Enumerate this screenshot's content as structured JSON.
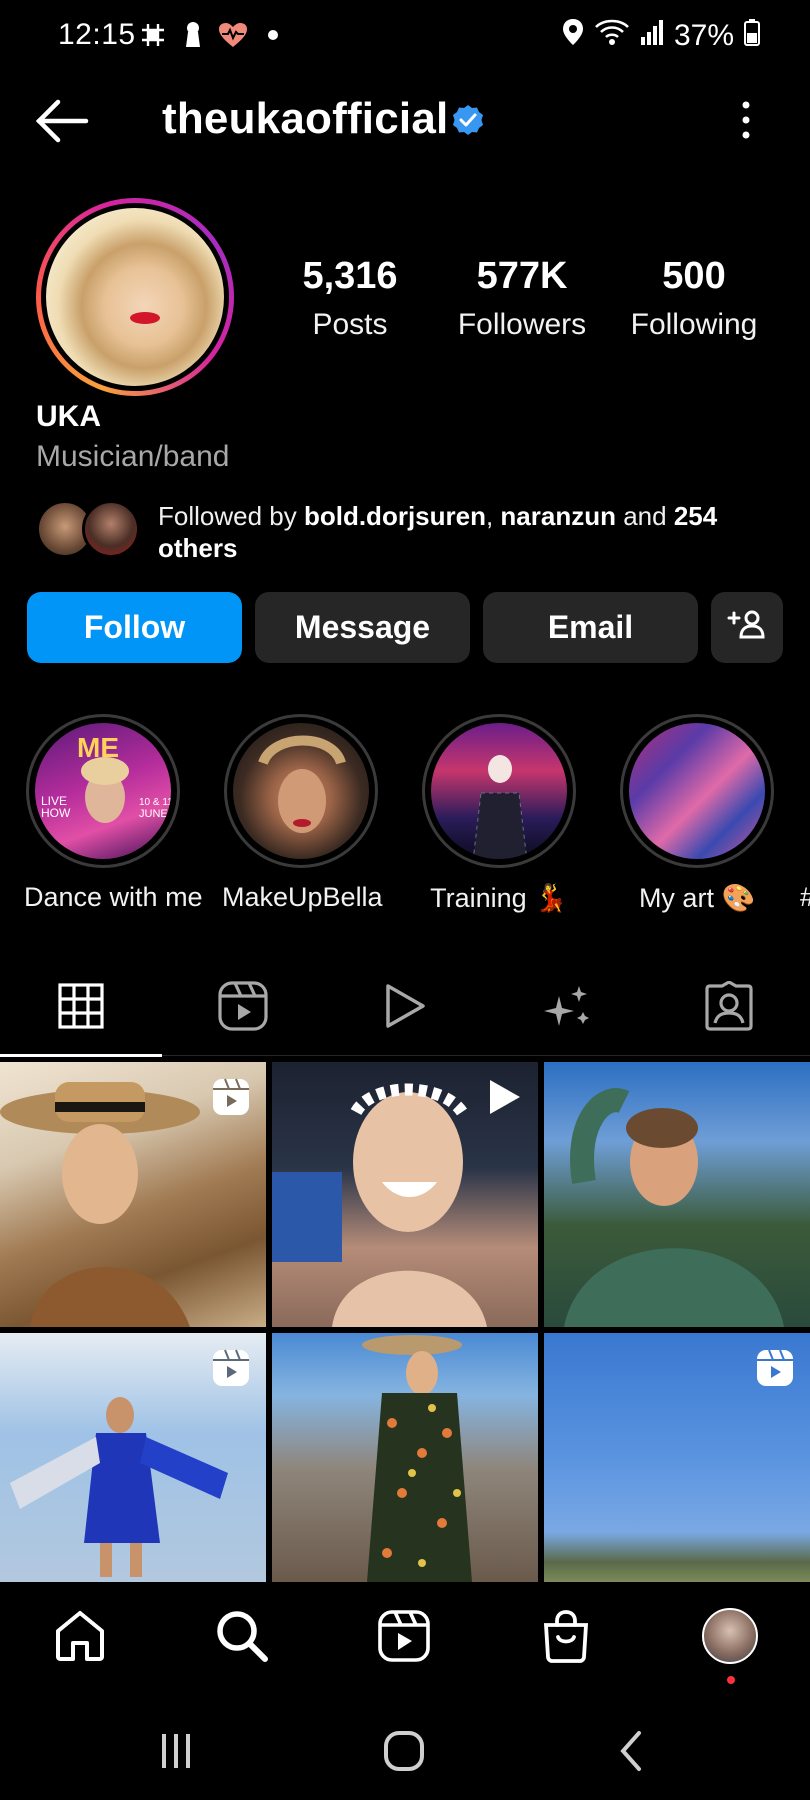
{
  "status_bar": {
    "time": "12:15",
    "battery": "37%",
    "left_icons": [
      "hashtag-grid-icon",
      "keyhole-icon",
      "heart-rate-icon",
      "dot-icon"
    ],
    "right_icons": [
      "location-icon",
      "wifi-icon",
      "signal-icon",
      "battery-icon"
    ]
  },
  "header": {
    "username": "theukaofficial",
    "verified": true,
    "back_icon": "back-arrow-icon",
    "menu_icon": "kebab-menu-icon"
  },
  "profile": {
    "stats": [
      {
        "value": "5,316",
        "label": "Posts"
      },
      {
        "value": "577K",
        "label": "Followers"
      },
      {
        "value": "500",
        "label": "Following"
      }
    ],
    "display_name": "UKA",
    "category": "Musician/band",
    "followed_by": {
      "prefix": "Followed by ",
      "user1": "bold.dorjsuren",
      "sep": ", ",
      "user2": "naranzun",
      "mid": " and ",
      "count": "254",
      "suffix": "others"
    }
  },
  "actions": {
    "follow": "Follow",
    "message": "Message",
    "email": "Email",
    "add_user_icon": "add-person-icon"
  },
  "highlights": [
    {
      "label": "Dance with me"
    },
    {
      "label": "MakeUpBella"
    },
    {
      "label": "Training 💃"
    },
    {
      "label": "My art 🎨"
    },
    {
      "label": "#"
    }
  ],
  "tabs": [
    "grid-icon",
    "reels-icon",
    "video-play-icon",
    "sparkles-icon",
    "tagged-person-icon"
  ],
  "grid": [
    {
      "badge": "reels-icon"
    },
    {
      "badge": "play-icon"
    },
    {
      "badge": null
    },
    {
      "badge": "reels-icon"
    },
    {
      "badge": null
    },
    {
      "badge": "reels-icon"
    }
  ],
  "bottom_nav": [
    "home-icon",
    "search-icon",
    "reels-icon",
    "shop-icon",
    "profile-avatar"
  ],
  "system_nav": [
    "recents-icon",
    "home-circle-icon",
    "back-chevron-icon"
  ],
  "colors": {
    "accent": "#0095f6",
    "button_grey": "#262626",
    "notification_dot": "#ff3040"
  }
}
